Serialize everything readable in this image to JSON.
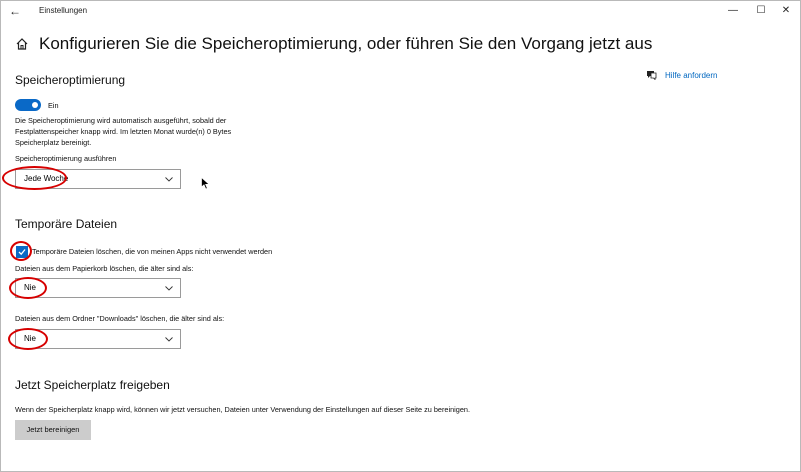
{
  "window": {
    "title": "Einstellungen",
    "back_glyph": "←",
    "minimize_glyph": "—",
    "maximize_glyph": "☐",
    "close_glyph": "✕"
  },
  "page": {
    "title": "Konfigurieren Sie die Speicheroptimierung, oder führen Sie den Vorgang jetzt aus"
  },
  "help": {
    "label": "Hilfe anfordern",
    "icon": "help-chat-icon"
  },
  "storage_sense": {
    "heading": "Speicheroptimierung",
    "toggle_label": "Ein",
    "toggle_on": true,
    "description_line1": "Die Speicheroptimierung wird automatisch ausgeführt, sobald der",
    "description_line2": "Festplattenspeicher knapp wird. Im letzten Monat wurde(n) 0 Bytes",
    "description_line3": "Speicherplatz bereinigt.",
    "run_label": "Speicheroptimierung ausführen",
    "run_value": "Jede Woche"
  },
  "temp_files": {
    "heading": "Temporäre Dateien",
    "checkbox_label": "Temporäre Dateien löschen, die von meinen Apps nicht verwendet werden",
    "checkbox_checked": true,
    "recycle_label": "Dateien aus dem Papierkorb löschen, die älter sind als:",
    "recycle_value": "Nie",
    "downloads_label": "Dateien aus dem Ordner \"Downloads\" löschen, die älter sind als:",
    "downloads_value": "Nie"
  },
  "free_now": {
    "heading": "Jetzt Speicherplatz freigeben",
    "description": "Wenn der Speicherplatz knapp wird, können wir jetzt versuchen, Dateien unter Verwendung der Einstellungen auf dieser Seite zu bereinigen.",
    "button_label": "Jetzt bereinigen"
  },
  "colors": {
    "accent": "#0a69c7",
    "link": "#0067c0",
    "annotation": "#d60000"
  }
}
